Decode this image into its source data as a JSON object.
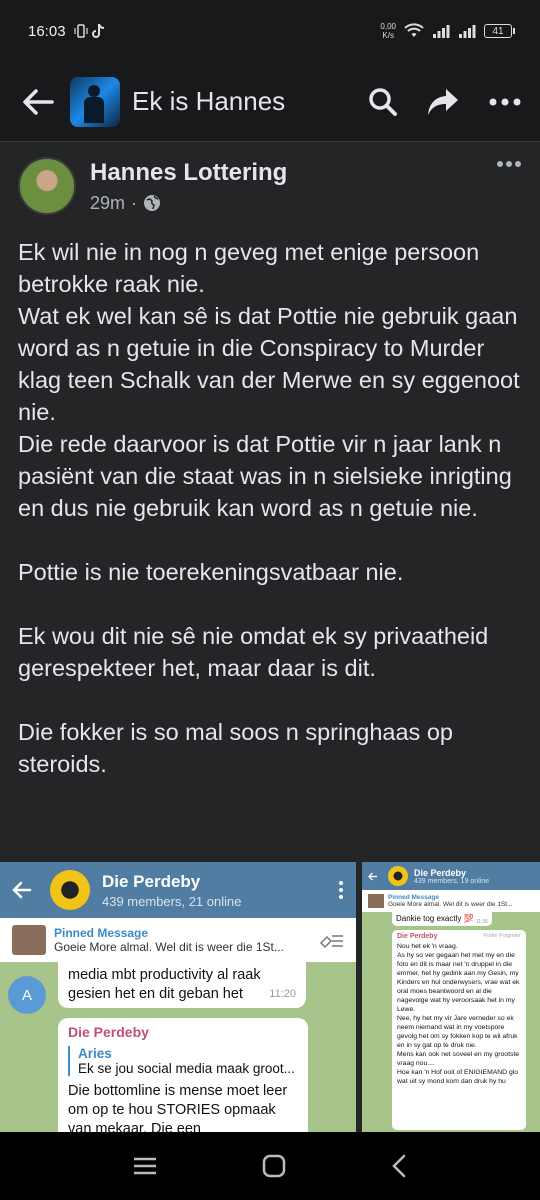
{
  "status_bar": {
    "time": "16:03",
    "net_speed_value": "0,00",
    "net_speed_unit": "K/s",
    "battery": "41"
  },
  "header": {
    "title": "Ek is Hannes"
  },
  "post": {
    "author": "Hannes Lottering",
    "time": "29m",
    "paragraphs": [
      "Ek wil nie in nog n geveg met enige persoon betrokke raak nie.\nWat ek wel kan sê is dat Pottie nie gebruik gaan word as n getuie in die Conspiracy to Murder klag teen Schalk van der Merwe en sy eggenoot nie.\nDie rede daarvoor is dat Pottie vir n jaar lank n pasiënt van die staat was in n sielsieke inrigting en dus nie gebruik kan word as n getuie nie.",
      "Pottie is nie toerekeningsvatbaar nie.",
      "Ek wou dit nie sê nie omdat ek sy privaatheid gerespekteer het, maar daar is dit.",
      "Die fokker is so mal soos n springhaas op steroids."
    ]
  },
  "screenshot_left": {
    "chat_title": "Die Perdeby",
    "chat_subtitle": "439 members, 21 online",
    "pinned_label": "Pinned Message",
    "pinned_text": "Goeie More almal. Wel dit is weer die 1St...",
    "msg1_text": "media mbt productivity al raak gesien het en dit geban het",
    "msg1_time": "11:20",
    "avatar_letter": "A",
    "msg2_sender": "Die Perdeby",
    "msg2_quote_name": "Aries",
    "msg2_quote_text": "Ek se jou social media maak groot...",
    "msg2_text": "Die bottomline is mense moet leer om op te hou STORIES opmaak van mekaar. Die een"
  },
  "screenshot_right": {
    "chat_title": "Die Perdeby",
    "chat_subtitle": "439 members, 19 online",
    "pinned_label": "Pinned Message",
    "pinned_text": "Goeie More almal. Wel dit is weer die 1St...",
    "top_msg": "Dankie tog exactly 💯",
    "top_time": "11:36",
    "msg_sender": "Die Perdeby",
    "msg_tag": "Pottie Potgieter",
    "msg_text": "Nou het ek 'n vraag.\nAs hy so ver gegaan het met my en die foto en dit is maar net 'n druppel in die emmer, het hy gedink aan my Gesin, my Kinders en hul onderwysers, vrae wat ek oral moes beantwoord en al die nagevolge wat hy veroorsaak het in my Lewe.\nNee, hy het my vir Jare verneder so ek neem niemand wat in my voetspore gevolg het om sy fokken kop te wil afruk en in sy gat op te druk nie.\nMens kan ook net soveel en my grootste vraag nou....\nHoe kan 'n Hof ooit of ENIGIEMAND glo wat uit sy mond kom dan druk hy hu"
  }
}
